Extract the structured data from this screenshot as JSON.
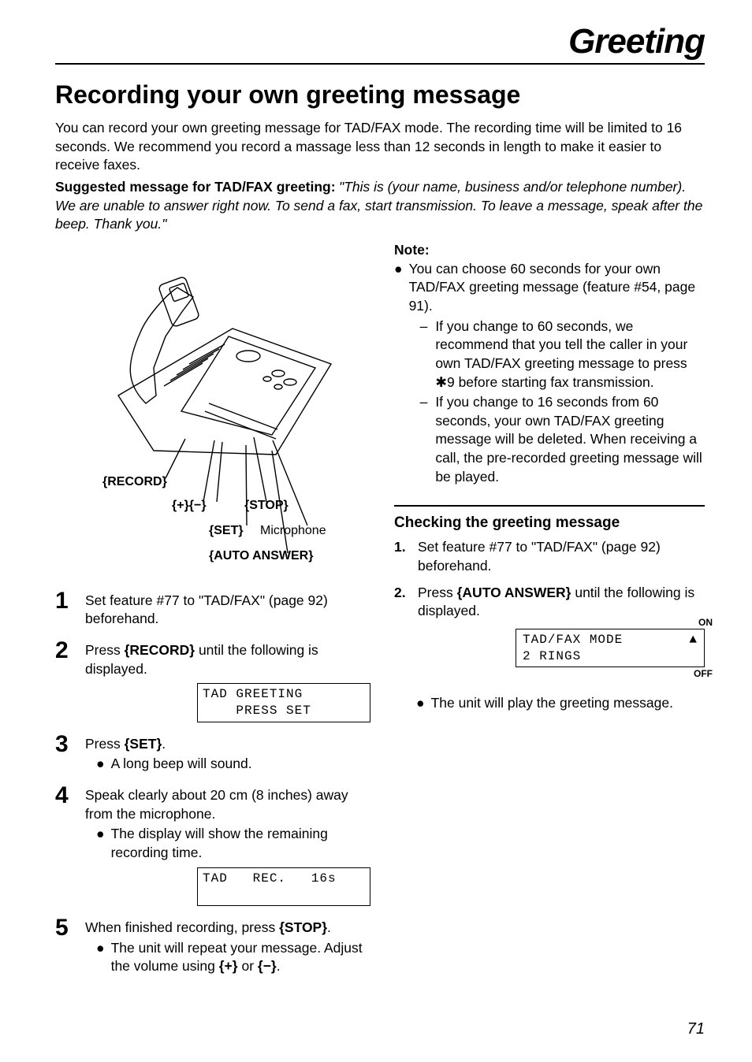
{
  "header": {
    "title": "Greeting"
  },
  "section": {
    "title": "Recording your own greeting message"
  },
  "intro": "You can record your own greeting message for TAD/FAX mode. The recording time will be limited to 16 seconds. We recommend you record a massage less than 12 seconds in length to make it easier to receive faxes.",
  "suggested": {
    "label": "Suggested message for TAD/FAX greeting:",
    "text": "\"This is (your name, business and/or telephone number). We are unable to answer right now. To send a fax, start transmission. To leave a message, speak after the beep. Thank you.\""
  },
  "figure": {
    "record": "{RECORD}",
    "plusminus": "{+}{−}",
    "stop": "{STOP}",
    "set": "{SET}",
    "microphone": "Microphone",
    "autoanswer": "{AUTO ANSWER}"
  },
  "steps": [
    {
      "n": "1",
      "body_pre": "Set feature #77 to \"TAD/FAX\" (page 92) beforehand."
    },
    {
      "n": "2",
      "body_pre": "Press ",
      "key": "{RECORD}",
      "body_post": " until the following is displayed.",
      "display": "TAD GREETING\n    PRESS SET"
    },
    {
      "n": "3",
      "body_pre": "Press ",
      "key": "{SET}",
      "body_post": ".",
      "bullet": "A long beep will sound."
    },
    {
      "n": "4",
      "body_pre": "Speak clearly about 20 cm (8 inches) away from the microphone.",
      "bullet": "The display will show the remaining recording time.",
      "display": "TAD   REC.   16s\n "
    },
    {
      "n": "5",
      "body_pre": "When finished recording, press ",
      "key": "{STOP}",
      "body_post": ".",
      "bullet_parts": {
        "pre": "The unit will repeat your message. Adjust the volume using ",
        "k1": "{+}",
        "mid": " or ",
        "k2": "{−}",
        "post": "."
      }
    }
  ],
  "note": {
    "head": "Note:",
    "bullet": "You can choose 60 seconds for your own TAD/FAX greeting message (feature #54, page 91).",
    "dash1": "If you change to 60 seconds, we recommend that you tell the caller in your own TAD/FAX greeting message to press ⁰9 before starting fax transmission.",
    "dash1_star": "9 before starting fax transmission.",
    "dash1_pre": "If you change to 60 seconds, we recommend that you tell the caller in your own TAD/FAX greeting message to press ",
    "dash2": "If you change to 16 seconds from 60 seconds, your own TAD/FAX greeting message will be deleted. When receiving a call, the pre-recorded greeting message will be played."
  },
  "check": {
    "heading": "Checking the greeting message",
    "step1": "Set feature #77 to \"TAD/FAX\" (page 92) beforehand.",
    "step2_pre": "Press ",
    "step2_key": "{AUTO ANSWER}",
    "step2_post": " until the following is displayed.",
    "on": "ON",
    "off": "OFF",
    "display_l1": "TAD/FAX MODE",
    "display_l2": "2 RINGS",
    "followup": "The unit will play the greeting message."
  },
  "page": {
    "num": "71"
  }
}
